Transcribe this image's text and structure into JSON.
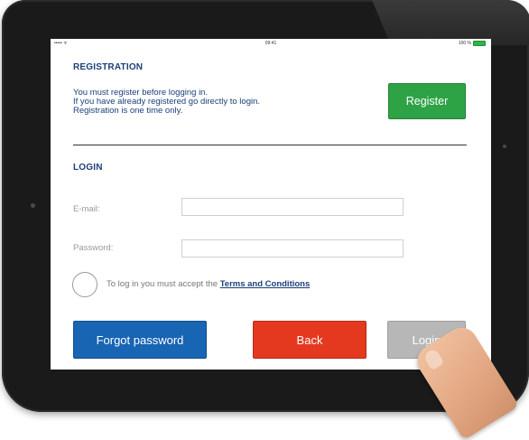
{
  "status_bar": {
    "signal": "••••• ᯤ",
    "time": "09:41",
    "battery_percent": "100 %"
  },
  "registration": {
    "title": "REGISTRATION",
    "lines": [
      "You must register before logging in.",
      "If you have already registered go directly to login.",
      "Registration is one time only."
    ],
    "register_label": "Register"
  },
  "login": {
    "title": "LOGIN",
    "email_label": "E-mail:",
    "email_value": "",
    "password_label": "Password:",
    "password_value": "",
    "terms_prefix": "To log in you must accept the ",
    "terms_link": "Terms and Conditions",
    "terms_accepted": false
  },
  "buttons": {
    "forgot_label": "Forgot password",
    "back_label": "Back",
    "login_label": "Login",
    "login_enabled": false
  },
  "colors": {
    "accent_blue": "#1c3f7a",
    "register_green": "#2ea346",
    "forgot_blue": "#1865b3",
    "back_red": "#e4391f",
    "login_disabled_gray": "#b7b7b7"
  }
}
